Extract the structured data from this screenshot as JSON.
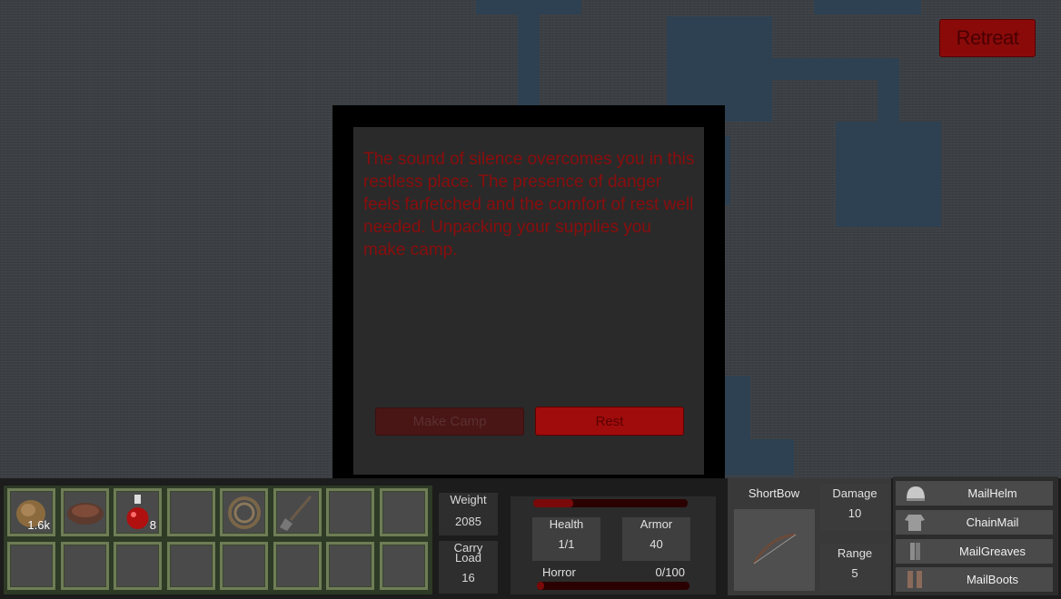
{
  "retreat_label": "Retreat",
  "dialog": {
    "text": "The sound of silence overcomes you in this restless place. The presence of danger feels farfetched and the comfort of rest well needed. Unpacking your supplies you make camp.",
    "make_camp_label": "Make Camp",
    "rest_label": "Rest"
  },
  "inventory": {
    "slots": [
      {
        "item": "bread-icon",
        "count": "1.6k"
      },
      {
        "item": "meat-icon",
        "count": ""
      },
      {
        "item": "potion-icon",
        "count": "8"
      },
      {
        "item": "",
        "count": ""
      },
      {
        "item": "rope-icon",
        "count": ""
      },
      {
        "item": "shovel-icon",
        "count": ""
      },
      {
        "item": "",
        "count": ""
      },
      {
        "item": "",
        "count": ""
      },
      {
        "item": "",
        "count": ""
      },
      {
        "item": "",
        "count": ""
      },
      {
        "item": "",
        "count": ""
      },
      {
        "item": "",
        "count": ""
      },
      {
        "item": "",
        "count": ""
      },
      {
        "item": "",
        "count": ""
      },
      {
        "item": "",
        "count": ""
      },
      {
        "item": "",
        "count": ""
      }
    ]
  },
  "weight": {
    "label": "Weight",
    "value": "2085"
  },
  "carry": {
    "label": "Carry Load",
    "value": "16"
  },
  "vitals": {
    "health_label": "Health",
    "health_value": "1/1",
    "armor_label": "Armor",
    "armor_value": "40",
    "horror_label": "Horror",
    "horror_value": "0/100",
    "top_bar_fraction": 0.26,
    "horror_fraction": 0.0
  },
  "weapon": {
    "name": "ShortBow",
    "icon": "bow-icon",
    "damage_label": "Damage",
    "damage_value": "10",
    "range_label": "Range",
    "range_value": "5"
  },
  "equipment": [
    {
      "name": "MailHelm",
      "icon": "helmet-icon"
    },
    {
      "name": "ChainMail",
      "icon": "chainmail-icon"
    },
    {
      "name": "MailGreaves",
      "icon": "greaves-icon"
    },
    {
      "name": "MailBoots",
      "icon": "boots-icon"
    }
  ],
  "colors": {
    "accent_red": "#a00c0c",
    "text_red": "#8a0d0d",
    "map_tile": "#2e4152"
  }
}
